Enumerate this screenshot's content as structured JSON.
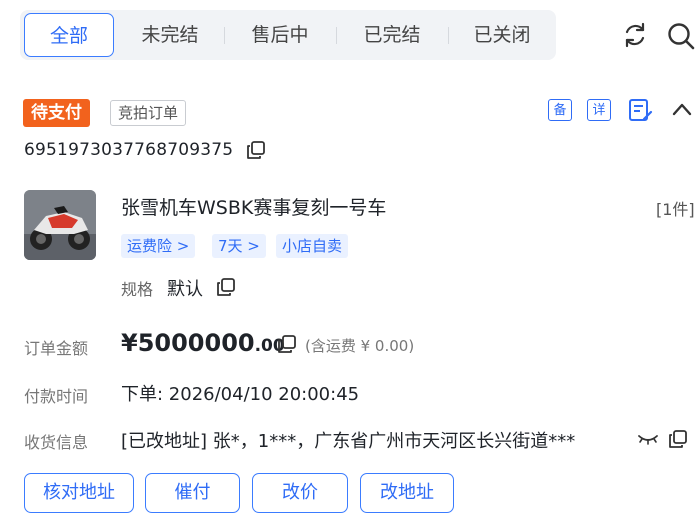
{
  "tabs": [
    {
      "label": "全部",
      "active": true
    },
    {
      "label": "未完结"
    },
    {
      "label": "售后中"
    },
    {
      "label": "已完结"
    },
    {
      "label": "已关闭"
    }
  ],
  "header_icons": [
    "refresh-icon",
    "search-icon"
  ],
  "order": {
    "status": "待支付",
    "type_tag": "竞拍订单",
    "order_no": "6951973037768709375",
    "action_icons": [
      {
        "label": "备",
        "name": "remark-icon"
      },
      {
        "label": "详",
        "name": "detail-icon"
      },
      {
        "label": "",
        "name": "edit-note-icon"
      },
      {
        "label": "",
        "name": "collapse-icon"
      }
    ],
    "product": {
      "title": "张雪机车WSBK赛事复刻一号车",
      "quantity": "[1件]",
      "chips": [
        "运费险 >",
        "7天 >",
        "小店自卖"
      ],
      "spec_label": "规格",
      "spec_value": "默认"
    },
    "amount_label": "订单金额",
    "amount_main": "¥5000000",
    "amount_decimal": ".00",
    "shipping_note": "(含运费 ¥ 0.00)",
    "pay_time_label": "付款时间",
    "pay_time_value": "下单: 2026/04/10 20:00:45",
    "address_label": "收货信息",
    "address_value": "[已改地址] 张*，1***，广东省广州市天河区长兴街道***",
    "actions": [
      "核对地址",
      "催付",
      "改价",
      "改地址"
    ]
  },
  "colors": {
    "accent": "#2f6cf6",
    "status_orange": "#f2621d",
    "tab_bg": "#f1f3f6"
  }
}
